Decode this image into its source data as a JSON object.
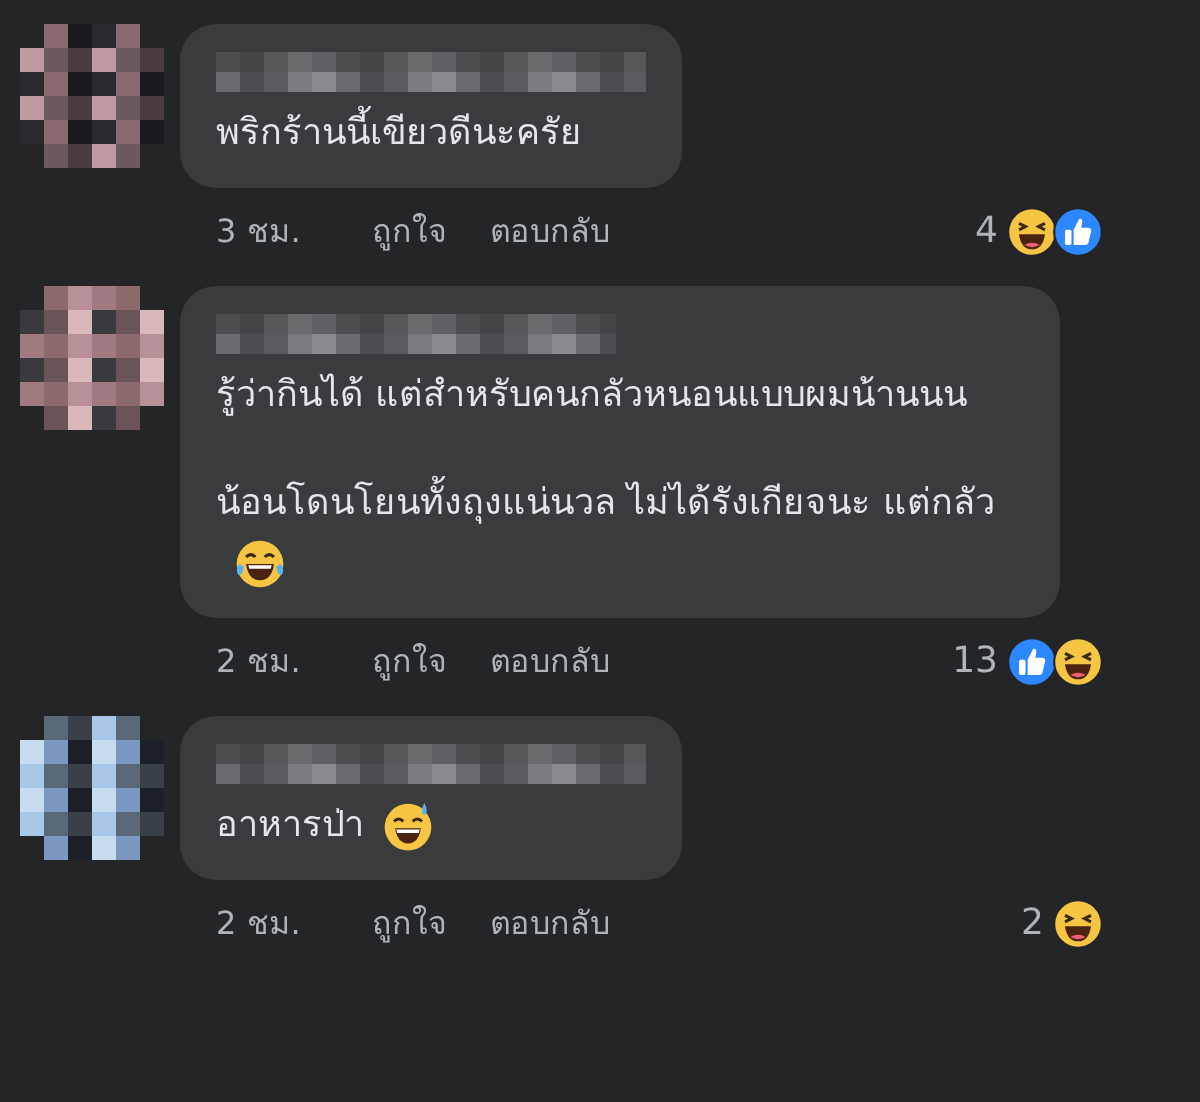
{
  "comments": [
    {
      "avatar": {
        "kind": "picture"
      },
      "paragraphs": [
        "พริกร้านนี้เขียวดีนะครัย"
      ],
      "time": "3 ชม.",
      "like": "ถูกใจ",
      "reply": "ตอบกลับ",
      "count": "4",
      "reactions": [
        {
          "kind": "haha"
        },
        {
          "kind": "like"
        }
      ]
    },
    {
      "avatar": {
        "kind": "picture"
      },
      "paragraphs": [
        "รู้ว่ากินได้ แต่สำหรับคนกลัวหนอนแบบผมน้านนน",
        "น้อนโดนโยนทั้งถุงแน่นวล ไม่ได้รังเกียจนะ แต่กลัว"
      ],
      "emoji": {
        "kind": "laugh-tears"
      },
      "time": "2 ชม.",
      "like": "ถูกใจ",
      "reply": "ตอบกลับ",
      "count": "13",
      "reactions": [
        {
          "kind": "like"
        },
        {
          "kind": "haha"
        }
      ]
    },
    {
      "avatar": {
        "kind": "picture"
      },
      "paragraphs": [
        "อาหารป่า"
      ],
      "emoji": {
        "kind": "sweat-smile"
      },
      "time": "2 ชม.",
      "like": "ถูกใจ",
      "reply": "ตอบกลับ",
      "count": "2",
      "reactions": [
        {
          "kind": "haha"
        }
      ]
    }
  ]
}
